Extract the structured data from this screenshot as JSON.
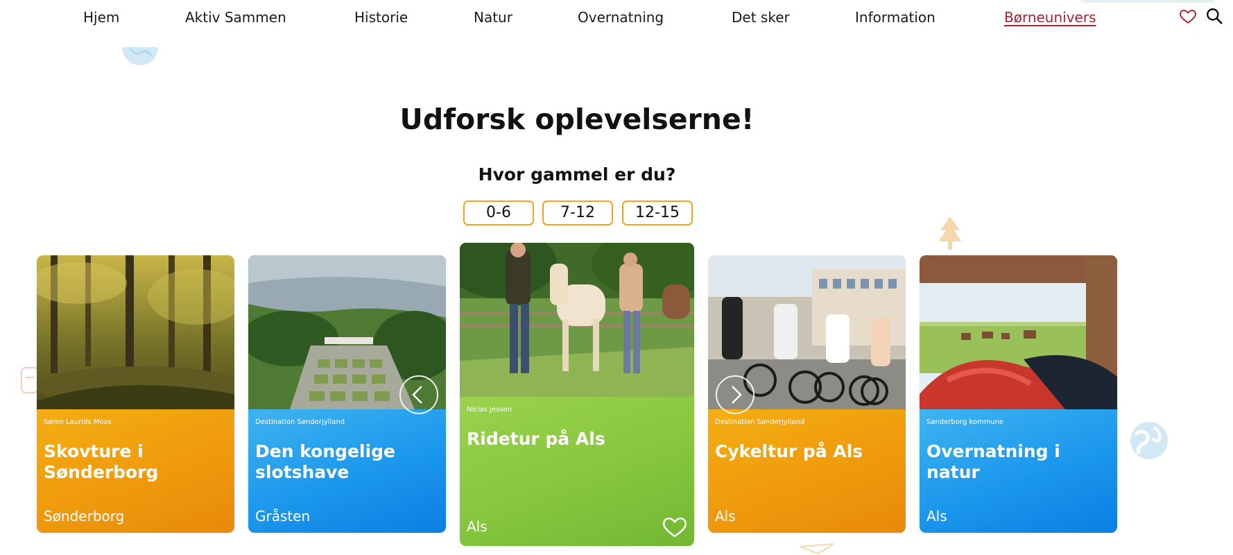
{
  "nav": {
    "items": [
      {
        "label": "Hjem"
      },
      {
        "label": "Aktiv Sammen"
      },
      {
        "label": "Historie"
      },
      {
        "label": "Natur"
      },
      {
        "label": "Overnatning"
      },
      {
        "label": "Det sker"
      },
      {
        "label": "Information"
      },
      {
        "label": "Børneunivers",
        "active": true
      }
    ],
    "icons": [
      "heart-outline-icon",
      "search-icon"
    ]
  },
  "heading": {
    "title": "Udforsk oplevelserne!",
    "subtitle": "Hvor gammel er du?"
  },
  "age_filters": [
    "0-6",
    "7-12",
    "12-15"
  ],
  "cards": [
    {
      "credit": "Søren Laurids Moos",
      "title": "Skovture i Sønderborg",
      "location": "Sønderborg",
      "color": "orange",
      "image": "forest path with trees"
    },
    {
      "credit": "Destination Sønderjylland",
      "title": "Den kongelige slotshave",
      "location": "Gråsten",
      "color": "blue",
      "image": "aerial view of palace garden"
    },
    {
      "credit": "Niclas Jessen",
      "title": "Ridetur på Als",
      "location": "Als",
      "color": "green",
      "image": "people walking with horses",
      "featured": true
    },
    {
      "credit": "Destination Sønderjylland",
      "title": "Cykeltur på Als",
      "location": "Als",
      "color": "orange",
      "image": "family with bicycles"
    },
    {
      "credit": "Sønderborg kommune",
      "title": "Overnatning i natur",
      "location": "Als",
      "color": "blue",
      "image": "sleeping bags in shelter with horses"
    }
  ],
  "carousel": {
    "prev_icon": "chevron-left-icon",
    "next_icon": "chevron-right-icon"
  },
  "colors": {
    "accent": "#f2a31b",
    "active_nav": "#a8222f",
    "orange": "#ef9a0c",
    "blue": "#1b97ec",
    "green": "#86c63e"
  }
}
